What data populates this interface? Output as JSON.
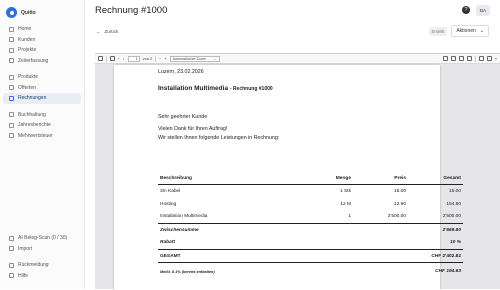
{
  "app": {
    "name": "Quitto"
  },
  "sidebar": {
    "items": [
      {
        "label": "Home"
      },
      {
        "label": "Kunden"
      },
      {
        "label": "Projekte"
      },
      {
        "label": "Zeiterfassung"
      }
    ],
    "items2": [
      {
        "label": "Produkte"
      },
      {
        "label": "Offerten"
      },
      {
        "label": "Rechnungen",
        "active": true
      }
    ],
    "items3": [
      {
        "label": "Buchhaltung"
      },
      {
        "label": "Jahresberichte"
      },
      {
        "label": "Mehrwertsteuer"
      }
    ],
    "bottom": [
      {
        "label": "AI Beleg-Scan (0 / 30)"
      },
      {
        "label": "Import"
      },
      {
        "label": "Rückmeldung"
      },
      {
        "label": "Hilfe"
      }
    ]
  },
  "header": {
    "title": "Rechnung #1000",
    "avatar": "BA",
    "help": "?"
  },
  "subbar": {
    "back": "Zurück",
    "status": "Erstellt",
    "actions": "Aktionen"
  },
  "viewer": {
    "page_number": "1",
    "page_total": "von 2",
    "zoom": "Automatischer Zoom"
  },
  "document": {
    "date": "Luzern, 23.02.2026",
    "title": "Installation Multimedia",
    "subtitle": "- Rechnung #1000",
    "greeting": "Sehr geehrter Kunde",
    "line1": "Vielen Dank für Ihren Auftrag!",
    "line2": "Wir stellen Ihnen folgende Leistungen in Rechnung:",
    "columns": [
      "Beschreibung",
      "Menge",
      "Preis",
      "Gesamt"
    ],
    "rows": [
      {
        "desc": "3m Kabel",
        "qty": "1 Stk",
        "price": "15.00",
        "total": "15.00"
      },
      {
        "desc": "Hosting",
        "qty": "12 M",
        "price": "12.90",
        "total": "154.80"
      },
      {
        "desc": "Installation Multimedia",
        "qty": "1",
        "price": "2'500.00",
        "total": "2'500.00"
      }
    ],
    "subtotal_label": "Zwischensumme",
    "subtotal": "2'669.80",
    "discount_label": "Rabatt",
    "discount": "10 %",
    "total_label": "GESAMT",
    "total": "CHF 2'402.82",
    "vat_label": "MwSt. 8.1% (bereits enthalten)",
    "vat": "CHF 194.63"
  }
}
